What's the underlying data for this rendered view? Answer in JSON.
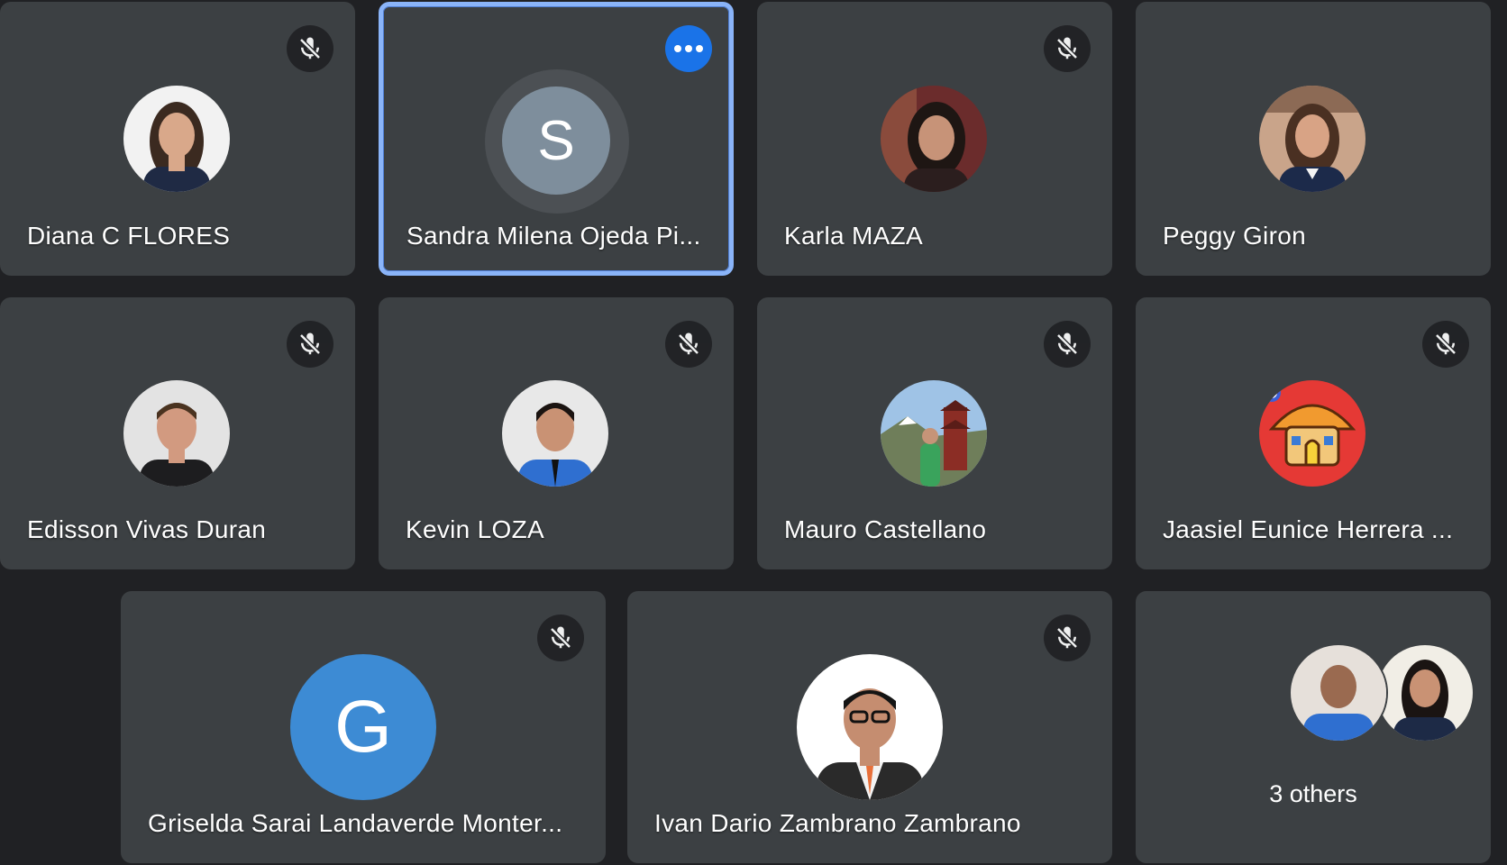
{
  "participants": [
    {
      "name": "Diana C FLORES",
      "muted": true,
      "avatar": "photo-woman-long-hair",
      "skin": "#d9a88a",
      "hair": "#3b2a20",
      "bg": "#f2f2f2",
      "shirt": "#1f2a44"
    },
    {
      "name": "Sandra Milena Ojeda Pi...",
      "muted": false,
      "avatar_letter": "S",
      "avatar_color": "#7e8e9c",
      "active_speaker": true
    },
    {
      "name": "Karla MAZA",
      "muted": true,
      "avatar": "photo-woman-dark-hair",
      "skin": "#c79378",
      "hair": "#1e1613",
      "bg": "#6b2c2c",
      "shirt": "#2b1e1e"
    },
    {
      "name": "Peggy Giron",
      "muted": true,
      "avatar": "photo-woman-light-hair",
      "skin": "#d8a385",
      "hair": "#4a3022",
      "bg": "#c9a48a",
      "shirt": "#1c2a4a"
    },
    {
      "name": "Edisson Vivas Duran",
      "muted": true,
      "avatar": "photo-man-short-hair",
      "skin": "#d29a80",
      "hair": "#4a3320",
      "bg": "#e3e3e3",
      "shirt": "#1d1d1f"
    },
    {
      "name": "Kevin LOZA",
      "muted": true,
      "avatar": "photo-man-blue-shirt",
      "skin": "#c99274",
      "hair": "#1b1411",
      "bg": "#e8e8e8",
      "shirt": "#2f6fd0"
    },
    {
      "name": "Mauro Castellano",
      "muted": true,
      "avatar": "photo-landscape-pagoda",
      "skin": "#c69478",
      "hair": "#2b2018",
      "bg": "#9fc3e6",
      "shirt": "#3aa35c"
    },
    {
      "name": "Jaasiel Eunice Herrera ...",
      "muted": true,
      "avatar": "cartoon-house-logo",
      "bg": "#e53935"
    },
    {
      "name": "Griselda Sarai Landaverde Monter...",
      "muted": true,
      "avatar_letter": "G",
      "avatar_color": "#3d8bd4"
    },
    {
      "name": "Ivan Dario Zambrano Zambrano",
      "muted": true,
      "avatar": "photo-man-glasses-suit",
      "skin": "#c58d70",
      "hair": "#141414",
      "bg": "#ffffff",
      "shirt": "#2a2a2a"
    }
  ],
  "others": {
    "label": "3 others",
    "avatars": [
      "photo-man-blue-shirt",
      "photo-woman-dark-hair"
    ]
  },
  "icons": {
    "mic_off": "mic-off-icon",
    "more": "more-options-icon"
  },
  "colors": {
    "background": "#202124",
    "tile": "#3c4043",
    "active_border": "#8ab4f8",
    "more_button": "#1a73e8"
  }
}
